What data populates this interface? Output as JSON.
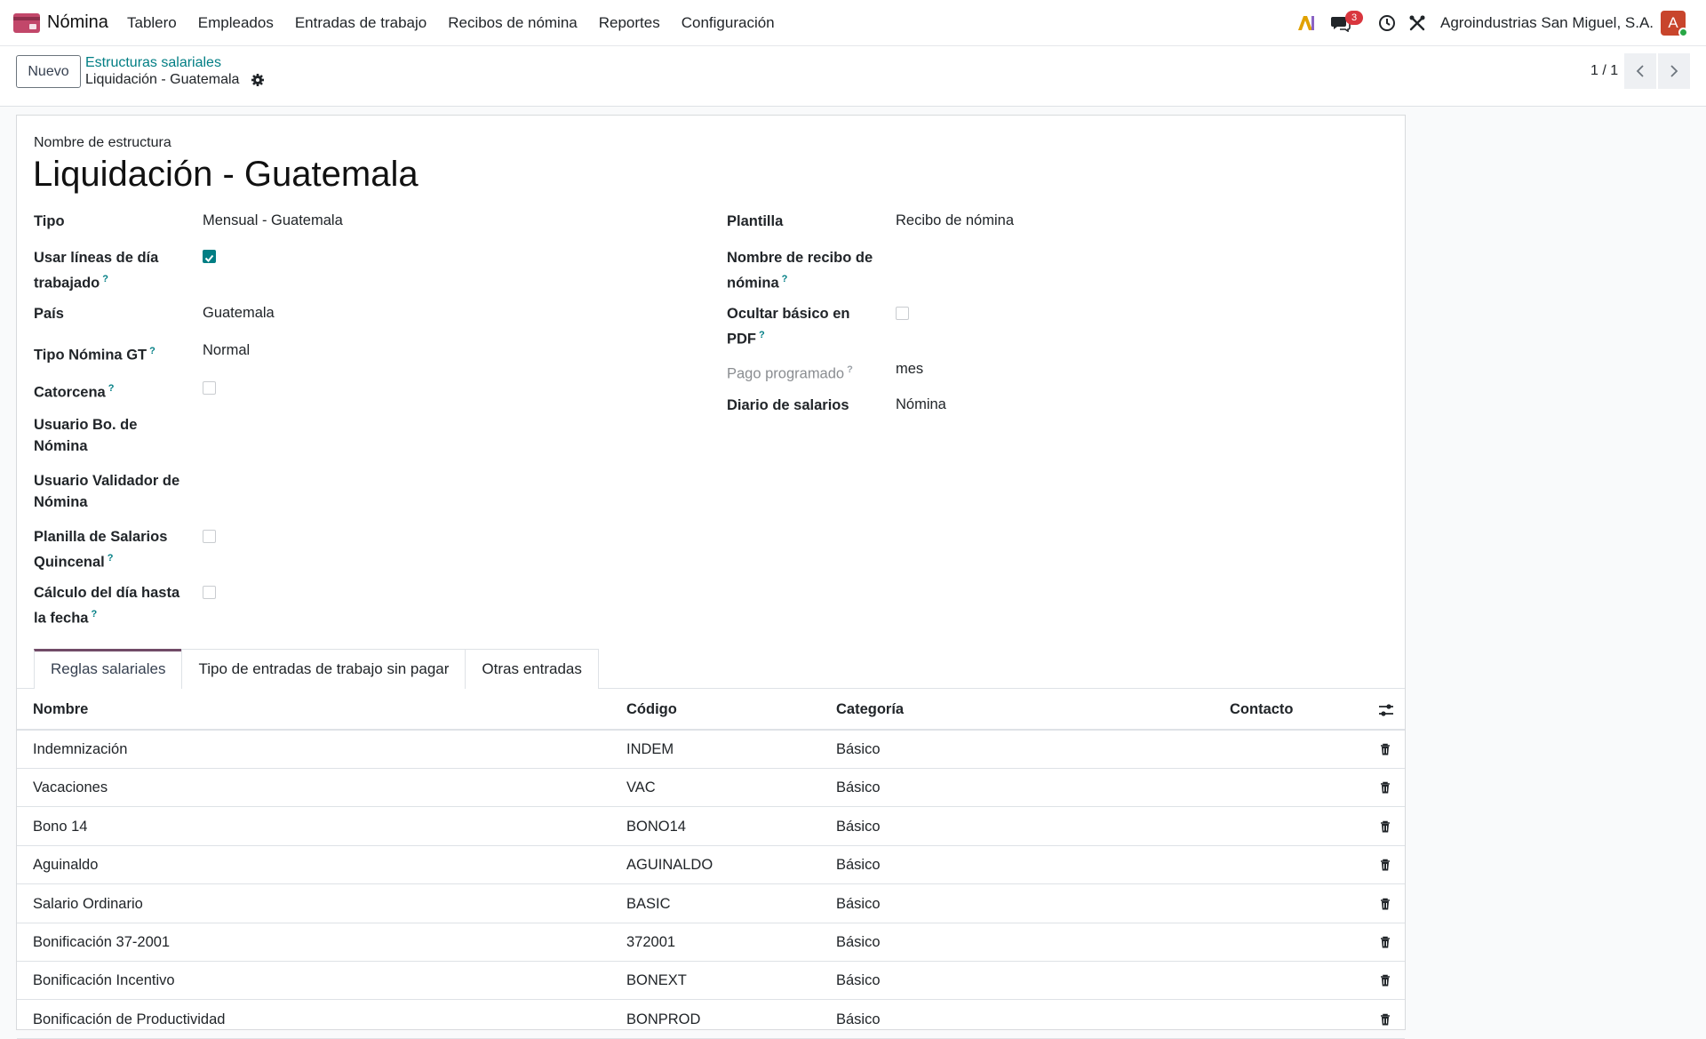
{
  "navbar": {
    "app_name": "Nómina",
    "menu": [
      "Tablero",
      "Empleados",
      "Entradas de trabajo",
      "Recibos de nómina",
      "Reportes",
      "Configuración"
    ],
    "messages_count": "3",
    "company": "Agroindustrias San Miguel, S.A.",
    "avatar_letter": "A"
  },
  "control": {
    "new_button": "Nuevo",
    "breadcrumb_parent": "Estructuras salariales",
    "breadcrumb_current": "Liquidación - Guatemala",
    "pager": "1 / 1"
  },
  "form": {
    "title_label": "Nombre de estructura",
    "title": "Liquidación - Guatemala",
    "left": {
      "tipo_label": "Tipo",
      "tipo_value": "Mensual - Guatemala",
      "usar_lineas_label": "Usar líneas de día trabajado",
      "usar_lineas_checked": true,
      "pais_label": "País",
      "pais_value": "Guatemala",
      "tipo_nomina_label": "Tipo Nómina GT",
      "tipo_nomina_value": "Normal",
      "catorcena_label": "Catorcena",
      "usuario_bo_label": "Usuario Bo. de Nómina",
      "usuario_validador_label": "Usuario Validador de Nómina",
      "planilla_label": "Planilla de Salarios Quincenal",
      "calculo_label": "Cálculo del día hasta la fecha"
    },
    "right": {
      "plantilla_label": "Plantilla",
      "plantilla_value": "Recibo de nómina",
      "nombre_recibo_label": "Nombre de recibo de nómina",
      "ocultar_label": "Ocultar básico en PDF",
      "pago_label": "Pago programado",
      "pago_value": "mes",
      "diario_label": "Diario de salarios",
      "diario_value": "Nómina"
    },
    "help_mark": "?"
  },
  "tabs": [
    "Reglas salariales",
    "Tipo de entradas de trabajo sin pagar",
    "Otras entradas"
  ],
  "table": {
    "columns": [
      "Nombre",
      "Código",
      "Categoría",
      "Contacto"
    ],
    "rows": [
      {
        "nombre": "Indemnización",
        "codigo": "INDEM",
        "categoria": "Básico"
      },
      {
        "nombre": "Vacaciones",
        "codigo": "VAC",
        "categoria": "Básico"
      },
      {
        "nombre": "Bono 14",
        "codigo": "BONO14",
        "categoria": "Básico"
      },
      {
        "nombre": "Aguinaldo",
        "codigo": "AGUINALDO",
        "categoria": "Básico"
      },
      {
        "nombre": "Salario Ordinario",
        "codigo": "BASIC",
        "categoria": "Básico"
      },
      {
        "nombre": "Bonificación 37-2001",
        "codigo": "372001",
        "categoria": "Básico"
      },
      {
        "nombre": "Bonificación Incentivo",
        "codigo": "BONEXT",
        "categoria": "Básico"
      },
      {
        "nombre": "Bonificación de Productividad",
        "codigo": "BONPROD",
        "categoria": "Básico"
      }
    ]
  },
  "colors": {
    "accent": "#017e84",
    "brand": "#714b67",
    "badge": "#d9363e"
  }
}
